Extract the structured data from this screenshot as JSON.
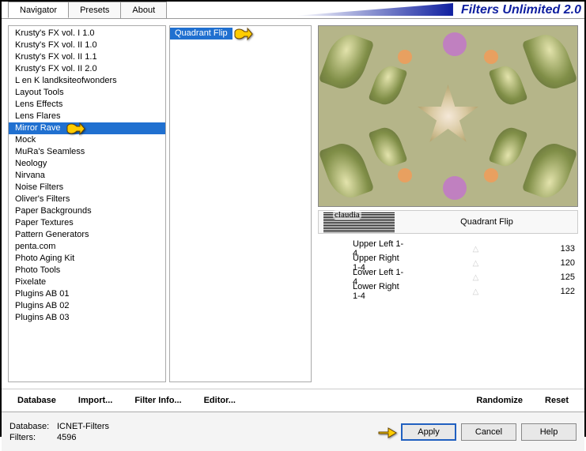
{
  "app_title": "Filters Unlimited 2.0",
  "tabs": {
    "navigator": "Navigator",
    "presets": "Presets",
    "about": "About"
  },
  "categories": [
    "Krusty's FX vol. I 1.0",
    "Krusty's FX vol. II 1.0",
    "Krusty's FX vol. II 1.1",
    "Krusty's FX vol. II 2.0",
    "L en K landksiteofwonders",
    "Layout Tools",
    "Lens Effects",
    "Lens Flares",
    "Mirror Rave",
    "Mock",
    "MuRa's Seamless",
    "Neology",
    "Nirvana",
    "Noise Filters",
    "Oliver's Filters",
    "Paper Backgrounds",
    "Paper Textures",
    "Pattern Generators",
    "penta.com",
    "Photo Aging Kit",
    "Photo Tools",
    "Pixelate",
    "Plugins AB 01",
    "Plugins AB 02",
    "Plugins AB 03"
  ],
  "selected_category_index": 8,
  "filters": [
    "Quadrant Flip"
  ],
  "selected_filter_index": 0,
  "param_title": "Quadrant Flip",
  "params": [
    {
      "label": "Upper Left 1-4",
      "value": 133
    },
    {
      "label": "Upper Right 1-4",
      "value": 120
    },
    {
      "label": "Lower Left 1-4",
      "value": 125
    },
    {
      "label": "Lower Right 1-4",
      "value": 122
    }
  ],
  "buttons": {
    "database": "Database",
    "import": "Import...",
    "filter_info": "Filter Info...",
    "editor": "Editor...",
    "randomize": "Randomize",
    "reset": "Reset",
    "apply": "Apply",
    "cancel": "Cancel",
    "help": "Help"
  },
  "footer": {
    "db_label": "Database:",
    "db_value": "ICNET-Filters",
    "filters_label": "Filters:",
    "filters_value": "4596"
  }
}
